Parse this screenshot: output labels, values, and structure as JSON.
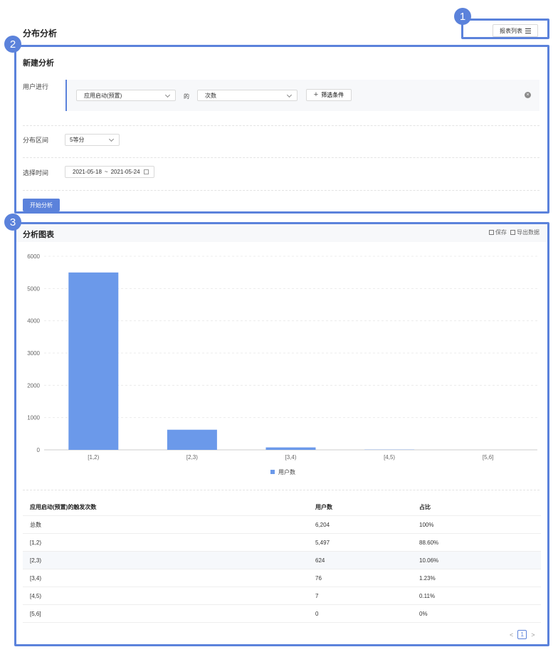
{
  "page": {
    "title": "分布分析",
    "report_list_label": "报表列表"
  },
  "badges": [
    "1",
    "2",
    "3"
  ],
  "new_analysis": {
    "title": "新建分析",
    "user_action_label": "用户进行",
    "event_select": "应用启动(预置)",
    "connector": "的",
    "metric_select": "次数",
    "add_filter_label": "筛选条件",
    "interval_label": "分布区间",
    "interval_select": "5等分",
    "time_label": "选择时间",
    "date_start": "2021-05-18",
    "date_sep": "~",
    "date_end": "2021-05-24",
    "start_button": "开始分析"
  },
  "chart_panel": {
    "title": "分析图表",
    "save_label": "保存",
    "export_label": "导出数据"
  },
  "chart_data": {
    "type": "bar",
    "categories": [
      "[1,2)",
      "[2,3)",
      "[3,4)",
      "[4,5)",
      "[5,6]"
    ],
    "series": [
      {
        "name": "用户数",
        "values": [
          5497,
          624,
          76,
          7,
          0
        ]
      }
    ],
    "yticks": [
      0,
      1000,
      2000,
      3000,
      4000,
      5000,
      6000
    ],
    "ylim": [
      0,
      6000
    ],
    "grid": true,
    "legend": "bottom",
    "color": "#6b99ea"
  },
  "table": {
    "headers": [
      "应用启动(预置)的触发次数",
      "用户数",
      "占比"
    ],
    "rows": [
      [
        "总数",
        "6,204",
        "100%"
      ],
      [
        "[1,2)",
        "5,497",
        "88.60%"
      ],
      [
        "[2,3)",
        "624",
        "10.06%"
      ],
      [
        "[3,4)",
        "76",
        "1.23%"
      ],
      [
        "[4,5)",
        "7",
        "0.11%"
      ],
      [
        "[5,6]",
        "0",
        "0%"
      ]
    ]
  },
  "pagination": {
    "prev": "<",
    "current": "1",
    "next": ">"
  },
  "colors": {
    "accent": "#5b82db",
    "bar": "#6b99ea"
  }
}
